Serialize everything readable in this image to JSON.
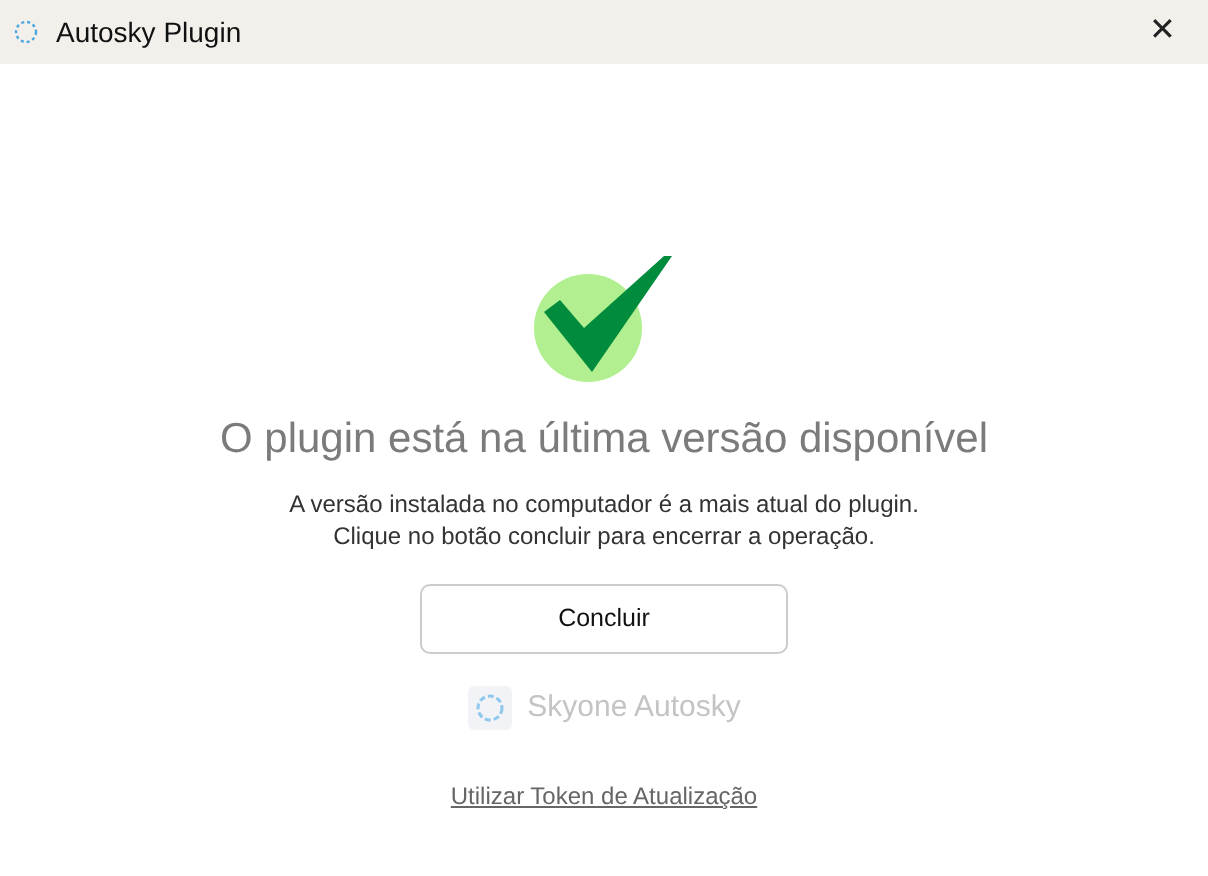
{
  "window": {
    "title": "Autosky Plugin",
    "close": "✕"
  },
  "heading": "O plugin está na última versão disponível",
  "message_lines": [
    "A versão instalada no computador é a mais atual do plugin.",
    "Clique no botão concluir para encerrar a operação."
  ],
  "button": "Concluir",
  "brand": "Skyone Autosky",
  "link": "Utilizar Token de Atualização"
}
